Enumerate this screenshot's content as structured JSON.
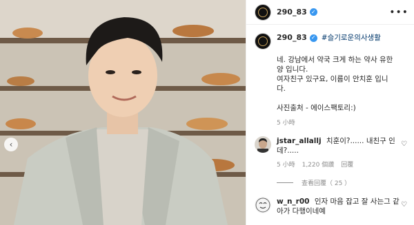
{
  "post": {
    "username": "290_83",
    "more_icon": "more-horizontal-icon"
  },
  "caption": {
    "username": "290_83",
    "hashtag": "#슬기로운의사생활",
    "lines": [
      "네. 강남에서 약국 크게 하는 약사 유한",
      "양 입니다.",
      "여자친구 있구요, 이름이 안치훈 입니",
      "다.",
      "사진출처 - 에이스팩토리:)"
    ],
    "time": "5 小時"
  },
  "comments": [
    {
      "username": "jstar_allallj",
      "text": "치훈이?...... 내친구 인데?.....",
      "time": "5 小時",
      "likes": "1,220 個讚",
      "reply": "回覆",
      "view_replies": "查看回覆（ 25 ）"
    },
    {
      "username": "w_n_r00",
      "text": "인자 마음 잡고 잘 사는그 같아가 다행이네예"
    }
  ],
  "colors": {
    "verified": "#3897f0",
    "hashtag": "#00376b",
    "muted": "#8e8e8e"
  }
}
